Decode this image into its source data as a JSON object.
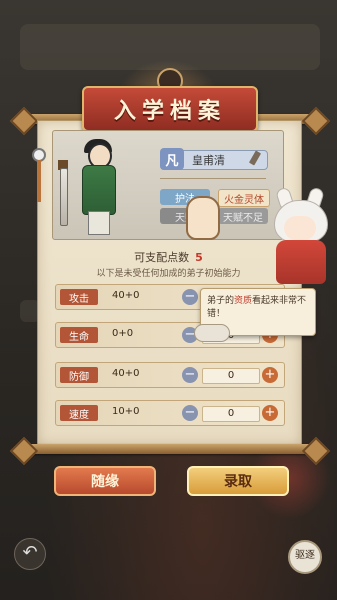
{
  "header": {
    "title": "入学档案"
  },
  "disciple": {
    "grade": "凡",
    "name": "皇甫清",
    "traits": [
      "护法",
      "火金灵体",
      "天赋",
      "天赋不足"
    ]
  },
  "points": {
    "label": "可支配点数",
    "value": "5"
  },
  "hint": "以下是未受任何加成的弟子初始能力",
  "stats": [
    {
      "label": "攻击",
      "value": "40+0",
      "alloc": "0"
    },
    {
      "label": "生命",
      "value": "0+0",
      "alloc": "0"
    },
    {
      "label": "防御",
      "value": "40+0",
      "alloc": "0"
    },
    {
      "label": "速度",
      "value": "10+0",
      "alloc": "0"
    }
  ],
  "speech": {
    "prefix": "弟子的",
    "highlight": "资质",
    "suffix": "看起来非常不错！"
  },
  "buttons": {
    "random": "随缘",
    "accept": "录取",
    "kick": "驱逐"
  },
  "controls": {
    "minus": "−",
    "plus": "+",
    "back": "↶"
  },
  "colors": {
    "banner": "#b5402f",
    "accent": "#c23a2a",
    "stat_label": "#b25637"
  }
}
